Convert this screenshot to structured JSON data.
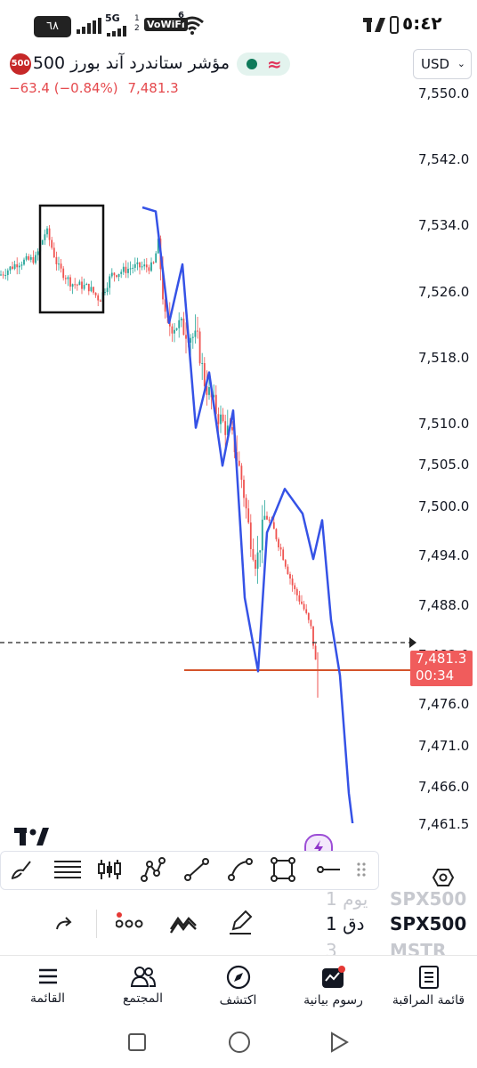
{
  "status_bar": {
    "time": "٥:٤٢",
    "battery": "٦٨",
    "network": "5G",
    "wifi_label": "VoWiFi",
    "sim_numbers": "1\n2",
    "wifi_badge": "6"
  },
  "header": {
    "title": "مؤشر ستاندرد آند بورز 500",
    "badge": "500",
    "last_price": "7,481.3",
    "change": "−63.4 (−0.84%)",
    "currency": "USD",
    "currency_chevron": "chevron-down-icon"
  },
  "price_axis": {
    "ticks": [
      "7,550.0",
      "7,542.0",
      "7,534.0",
      "7,526.0",
      "7,518.0",
      "7,510.0",
      "7,505.0",
      "7,500.0",
      "7,494.0",
      "7,488.0",
      "7,482.0",
      "7,476.0",
      "7,471.0",
      "7,466.0",
      "7,461.5"
    ],
    "current_price": "7,481.3",
    "countdown": "00:34"
  },
  "chart_data": {
    "type": "candlestick",
    "ylim": [
      7458,
      7555
    ],
    "current_price": 7481.3,
    "horizontal_line": 7479.2,
    "drawn_path": [
      [
        160,
        7536.2
      ],
      [
        175,
        7535.7
      ],
      [
        190,
        7522.2
      ],
      [
        205,
        7529.3
      ],
      [
        220,
        7509.5
      ],
      [
        235,
        7516.2
      ],
      [
        250,
        7504.9
      ],
      [
        262,
        7511.6
      ],
      [
        275,
        7488.9
      ],
      [
        290,
        7480.0
      ],
      [
        300,
        7496.8
      ],
      [
        320,
        7502.1
      ],
      [
        340,
        7499.1
      ],
      [
        352,
        7493.6
      ],
      [
        362,
        7498.3
      ],
      [
        372,
        7486.2
      ],
      [
        382,
        7479.5
      ],
      [
        392,
        7465.2
      ],
      [
        402,
        7456.5
      ]
    ],
    "series_colors": {
      "up": "#26a69a",
      "down": "#ef5350",
      "drawn_line": "#3552e6",
      "hline": "#d4542b"
    }
  },
  "toolbar": {
    "tools": [
      "brush-icon",
      "fib-retracement-icon",
      "candles-icon",
      "pattern-icon",
      "trend-line-icon",
      "curve-icon",
      "rectangle-icon",
      "horizontal-ray-icon",
      "drag-handle-icon"
    ],
    "settings_icon": "hexagon-icon"
  },
  "symbol_list": {
    "rows": [
      {
        "symbol": "SPX500",
        "interval": "1 يوم",
        "faded": true
      },
      {
        "symbol": "SPX500",
        "interval": "1 دق",
        "faded": false
      },
      {
        "symbol": "MSTR",
        "interval": "3",
        "faded": true
      }
    ]
  },
  "action_bar": {
    "icons": [
      "redo-icon",
      "more-dots-icon",
      "indicators-icon",
      "pencil-icon"
    ]
  },
  "bottom_nav": {
    "items": [
      {
        "label": "القائمة",
        "icon": "menu-icon"
      },
      {
        "label": "المجتمع",
        "icon": "community-icon"
      },
      {
        "label": "اكتشف",
        "icon": "compass-icon"
      },
      {
        "label": "رسوم بيانية",
        "icon": "charts-icon"
      },
      {
        "label": "قائمة المراقبة",
        "icon": "watchlist-icon"
      }
    ]
  },
  "system_nav": {
    "icons": [
      "recents-icon",
      "home-icon",
      "back-icon"
    ]
  }
}
